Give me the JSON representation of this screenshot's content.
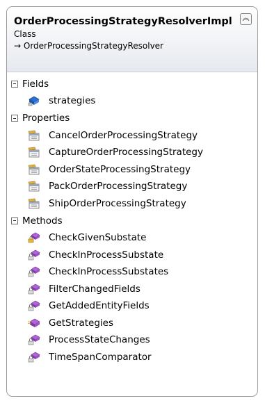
{
  "header": {
    "title": "OrderProcessingStrategyResolverImpl",
    "kind": "Class",
    "base": "→ OrderProcessingStrategyResolver",
    "collapse_glyph": "︽"
  },
  "sections": {
    "fields": {
      "label": "Fields",
      "items": [
        {
          "name": "strategies",
          "icon": "field-icon"
        }
      ]
    },
    "properties": {
      "label": "Properties",
      "items": [
        {
          "name": "CancelOrderProcessingStrategy",
          "icon": "property-icon"
        },
        {
          "name": "CaptureOrderProcessingStrategy",
          "icon": "property-icon"
        },
        {
          "name": "OrderStateProcessingStrategy",
          "icon": "property-icon"
        },
        {
          "name": "PackOrderProcessingStrategy",
          "icon": "property-icon"
        },
        {
          "name": "ShipOrderProcessingStrategy",
          "icon": "property-icon"
        }
      ]
    },
    "methods": {
      "label": "Methods",
      "items": [
        {
          "name": "CheckGivenSubstate",
          "icon": "protected-method-icon"
        },
        {
          "name": "CheckInProcessSubstate",
          "icon": "private-method-icon"
        },
        {
          "name": "CheckInProcessSubstates",
          "icon": "private-method-icon"
        },
        {
          "name": "FilterChangedFields",
          "icon": "private-method-icon"
        },
        {
          "name": "GetAddedEntityFields",
          "icon": "private-method-icon"
        },
        {
          "name": "GetStrategies",
          "icon": "public-method-icon"
        },
        {
          "name": "ProcessStateChanges",
          "icon": "private-method-icon"
        },
        {
          "name": "TimeSpanComparator",
          "icon": "private-method-icon"
        }
      ]
    }
  },
  "colors": {
    "method_purple": "#8a3fb0",
    "field_blue": "#2d6fd0",
    "property_gold": "#e3b23c"
  }
}
